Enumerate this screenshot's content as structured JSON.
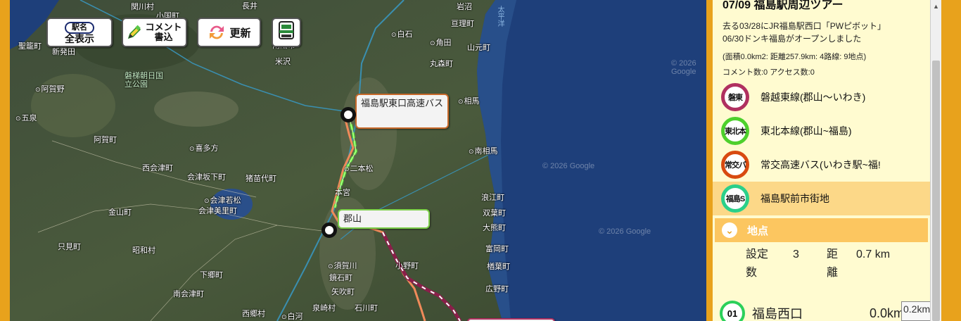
{
  "toolbar": {
    "all_pill": "駅名",
    "all_label": "全表示",
    "comment_line1": "コメント",
    "comment_line2": "書込",
    "refresh_label": "更新"
  },
  "map": {
    "watermark": "© 2026 Google",
    "places": [
      {
        "name": "関川村"
      },
      {
        "name": "小国町"
      },
      {
        "name": "長井"
      },
      {
        "name": "南陽市"
      },
      {
        "name": "米沢"
      },
      {
        "name": "白石"
      },
      {
        "name": "角田"
      },
      {
        "name": "亘理町"
      },
      {
        "name": "山元町"
      },
      {
        "name": "丸森町"
      },
      {
        "name": "相馬"
      },
      {
        "name": "南相馬"
      },
      {
        "name": "聖籠町"
      },
      {
        "name": "新発田"
      },
      {
        "name": "阿賀野"
      },
      {
        "name": "五泉"
      },
      {
        "name": "阿賀町"
      },
      {
        "name": "喜多方"
      },
      {
        "name": "西会津町"
      },
      {
        "name": "会津坂下町"
      },
      {
        "name": "猪苗代町"
      },
      {
        "name": "会津若松"
      },
      {
        "name": "会津美里町"
      },
      {
        "name": "二本松"
      },
      {
        "name": "本宮"
      },
      {
        "name": "金山町"
      },
      {
        "name": "只見町"
      },
      {
        "name": "昭和村"
      },
      {
        "name": "下郷町"
      },
      {
        "name": "南会津町"
      },
      {
        "name": "須賀川"
      },
      {
        "name": "鏡石町"
      },
      {
        "name": "矢吹町"
      },
      {
        "name": "泉崎村"
      },
      {
        "name": "石川町"
      },
      {
        "name": "西郷村"
      },
      {
        "name": "白河"
      },
      {
        "name": "小野町"
      },
      {
        "name": "浪江町"
      },
      {
        "name": "双葉町"
      },
      {
        "name": "大熊町"
      },
      {
        "name": "富岡町"
      },
      {
        "name": "楢葉町"
      },
      {
        "name": "広野町"
      },
      {
        "name": "岩沼"
      },
      {
        "name": "磐梯朝日国立公園"
      },
      {
        "name": "太平洋"
      }
    ],
    "callouts": {
      "fukushima_east": "福島駅東口高速バス",
      "koriyama": "郡山"
    }
  },
  "panel": {
    "title": "07/09 福島駅周辺ツアー",
    "desc_line1": "去る03/28にJR福島駅西口「PWピボット」",
    "desc_line2": "06/30ドンキ福島がオープンしました",
    "stats_line1": "(面積0.0km2: 距離257.9km: 4路線: 9地点)",
    "stats_line2": "コメント数:0 アクセス数:0",
    "routes": [
      {
        "badge": "磐東",
        "name": "磐越東線(郡山～いわき)",
        "color": "#b03060"
      },
      {
        "badge": "東北本",
        "name": "東北本線(郡山~福島)",
        "color": "#4ed02c"
      },
      {
        "badge": "常交バ",
        "name": "常交高速バス(いわき駅~福!",
        "color": "#d84a10"
      },
      {
        "badge": "福島S",
        "name": "福島駅前市街地",
        "color": "#2bd08a"
      }
    ],
    "points_section": "地点",
    "chevron": "⌄",
    "point_stats": {
      "count_label_1": "設定",
      "count_label_2": "数",
      "count_value": "3",
      "dist_label_1": "距",
      "dist_label_2": "離",
      "dist_value": "0.7 km"
    },
    "stop": {
      "num": "01",
      "name": "福島西口",
      "dist": "0.0km"
    },
    "tooltip": "0.2km"
  }
}
